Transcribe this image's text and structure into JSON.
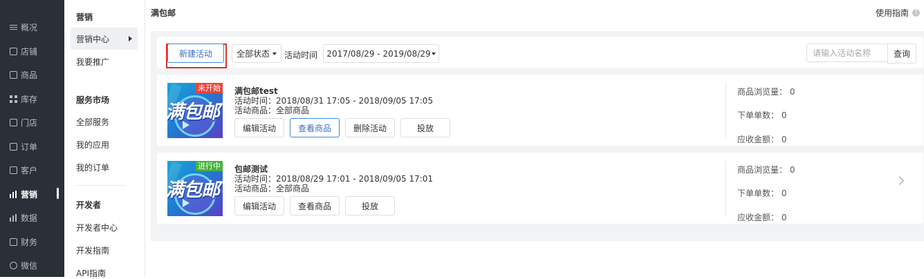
{
  "sidebar": {
    "items": [
      {
        "label": "概况",
        "icon": "list-icon"
      },
      {
        "label": "店铺",
        "icon": "store-icon"
      },
      {
        "label": "商品",
        "icon": "product-icon"
      },
      {
        "label": "库存",
        "icon": "grid-icon"
      },
      {
        "label": "门店",
        "icon": "shop-icon"
      },
      {
        "label": "订单",
        "icon": "order-icon"
      },
      {
        "label": "客户",
        "icon": "customer-icon"
      },
      {
        "label": "营销",
        "icon": "bar-chart-icon",
        "active": true
      },
      {
        "label": "数据",
        "icon": "line-chart-icon"
      },
      {
        "label": "财务",
        "icon": "finance-icon"
      },
      {
        "label": "微信",
        "icon": "chat-icon"
      }
    ]
  },
  "subnav": {
    "marketing": {
      "title": "营销",
      "active_item": "营销中心",
      "items": [
        "我要推广"
      ]
    },
    "service_market": {
      "title": "服务市场",
      "items": [
        "全部服务",
        "我的应用",
        "我的订单"
      ]
    },
    "developer": {
      "title": "开发者",
      "items": [
        "开发者中心",
        "开发指南",
        "API指南"
      ]
    }
  },
  "header": {
    "title": "满包邮",
    "guide_label": "使用指南",
    "help_glyph": "?"
  },
  "filters": {
    "new_button": "新建活动",
    "status_select": "全部状态",
    "time_label": "活动时间",
    "date_range": "2017/08/29 - 2019/08/29",
    "search_placeholder": "请输入活动名称",
    "search_button": "查询"
  },
  "activities": [
    {
      "title": "满包邮test",
      "status": "未开始",
      "thumb_text": "满包邮",
      "time": "活动时间：2018/08/31 17:05 - 2018/09/05 17:05",
      "goods": "活动商品：全部商品",
      "actions": [
        "编辑活动",
        "查看商品",
        "删除活动",
        "投放"
      ],
      "stats": {
        "views": "商品浏览量：  0",
        "orders": "下单单数：  0",
        "amount": "应收金额：  0"
      }
    },
    {
      "title": "包邮测试",
      "status": "进行中",
      "thumb_text": "满包邮",
      "time": "活动时间：2018/08/29 17:01 - 2018/09/05 17:01",
      "goods": "活动商品：全部商品",
      "actions": [
        "编辑活动",
        "查看商品",
        "投放"
      ],
      "stats": {
        "views": "商品浏览量：  0",
        "orders": "下单单数：  0",
        "amount": "应收金额：  0"
      }
    }
  ],
  "colors": {
    "sidebar_bg": "#2b2f37",
    "accent_blue": "#3d8ae0",
    "highlight_red": "#e0302c",
    "tag_red": "#e8453c",
    "tag_green": "#46b43e"
  }
}
